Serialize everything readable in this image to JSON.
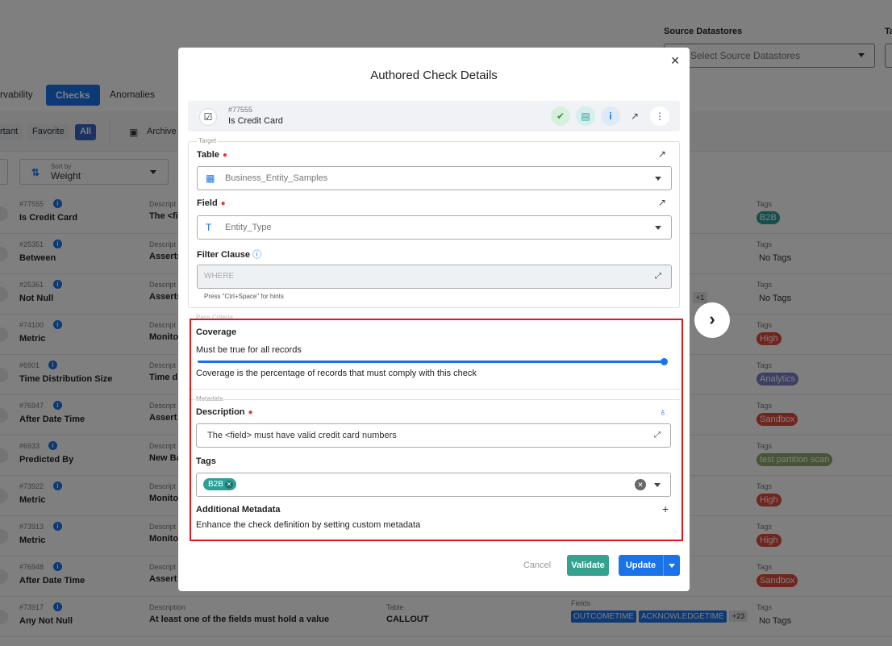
{
  "background": {
    "source_datastores_label": "Source Datastores",
    "source_datastores_label2": "Ta",
    "source_datastores_placeholder": "Select Source Datastores",
    "tabs": [
      "rvability",
      "Checks",
      "Anomalies"
    ],
    "filters": [
      "rtant",
      "Favorite",
      "All"
    ],
    "archived_label": "Archive",
    "sort_small": "Sort by",
    "sort_value": "Weight",
    "rows": [
      {
        "id": "#77555",
        "name": "Is Credit Card",
        "desc_label": "Descript",
        "desc": "The <fi",
        "tags_label": "Tags",
        "tag": "B2B",
        "tag_color": "#2aa198"
      },
      {
        "id": "#25351",
        "name": "Between",
        "desc_label": "Descript",
        "desc": "Asserts",
        "tags_label": "Tags",
        "tag": "No Tags",
        "tag_color": ""
      },
      {
        "id": "#25361",
        "name": "Not Null",
        "desc_label": "Descript",
        "desc": "Asserts",
        "tags_label": "Tags",
        "tag": "No Tags",
        "tag_color": "",
        "extra": "+1"
      },
      {
        "id": "#74100",
        "name": "Metric",
        "desc_label": "Descript",
        "desc": "Monito",
        "tags_label": "Tags",
        "tag": "High",
        "tag_color": "#e04b3c"
      },
      {
        "id": "#6901",
        "name": "Time Distribution Size",
        "desc_label": "Descript",
        "desc": "Time di",
        "tags_label": "Tags",
        "tag": "Analytics",
        "tag_color": "#7b7fc9"
      },
      {
        "id": "#76947",
        "name": "After Date Time",
        "desc_label": "Descript",
        "desc": "Assert",
        "tags_label": "Tags",
        "tag": "Sandbox",
        "tag_color": "#e04b3c"
      },
      {
        "id": "#6933",
        "name": "Predicted By",
        "desc_label": "Descript",
        "desc": "New Ba",
        "tags_label": "Tags",
        "tag": "test partition scan",
        "tag_color": "#8fa86a"
      },
      {
        "id": "#73922",
        "name": "Metric",
        "desc_label": "Descript",
        "desc": "Monito",
        "tags_label": "Tags",
        "tag": "High",
        "tag_color": "#e04b3c"
      },
      {
        "id": "#73913",
        "name": "Metric",
        "desc_label": "Descript",
        "desc": "Monito",
        "tags_label": "Tags",
        "tag": "High",
        "tag_color": "#e04b3c"
      },
      {
        "id": "#76948",
        "name": "After Date Time",
        "desc_label": "Descript",
        "desc": "Assert",
        "tags_label": "Tags",
        "tag": "Sandbox",
        "tag_color": "#e04b3c"
      },
      {
        "id": "#73917",
        "name": "Any Not Null",
        "desc_label": "Description",
        "desc": "At least one of the fields must hold a value",
        "table_label": "Table",
        "table": "CALLOUT",
        "fields_label": "Fields",
        "fields": [
          "OUTCOMETIME",
          "ACKNOWLEDGETIME"
        ],
        "fields_more": "+23",
        "tags_label": "Tags",
        "tag": "No Tags",
        "tag_color": ""
      }
    ]
  },
  "modal": {
    "title": "Authored Check Details",
    "check_id": "#77555",
    "check_name": "Is Credit Card",
    "target_legend": "Target",
    "table_label": "Table",
    "table_value": "Business_Entity_Samples",
    "field_label": "Field",
    "field_value": "Entity_Type",
    "filter_label": "Filter Clause",
    "filter_placeholder": "WHERE",
    "filter_hint": "Press \"Ctrl+Space\" for hints",
    "coverage_legend": "Pass Criteria",
    "coverage_label": "Coverage",
    "coverage_value_text": "Must be true for all records",
    "coverage_fraction": 1.0,
    "coverage_help": "Coverage is the percentage of records that must comply with this check",
    "metadata_legend": "Metadata",
    "description_label": "Description",
    "description_value": "The <field> must have valid credit card numbers",
    "tags_label": "Tags",
    "tags": [
      "B2B"
    ],
    "additional_metadata_label": "Additional Metadata",
    "additional_metadata_help": "Enhance the check definition by setting custom metadata",
    "cancel_label": "Cancel",
    "validate_label": "Validate",
    "update_label": "Update"
  },
  "colors": {
    "accent": "#1a73e8",
    "validate": "#35a28f",
    "highlight": "#e0171b"
  }
}
